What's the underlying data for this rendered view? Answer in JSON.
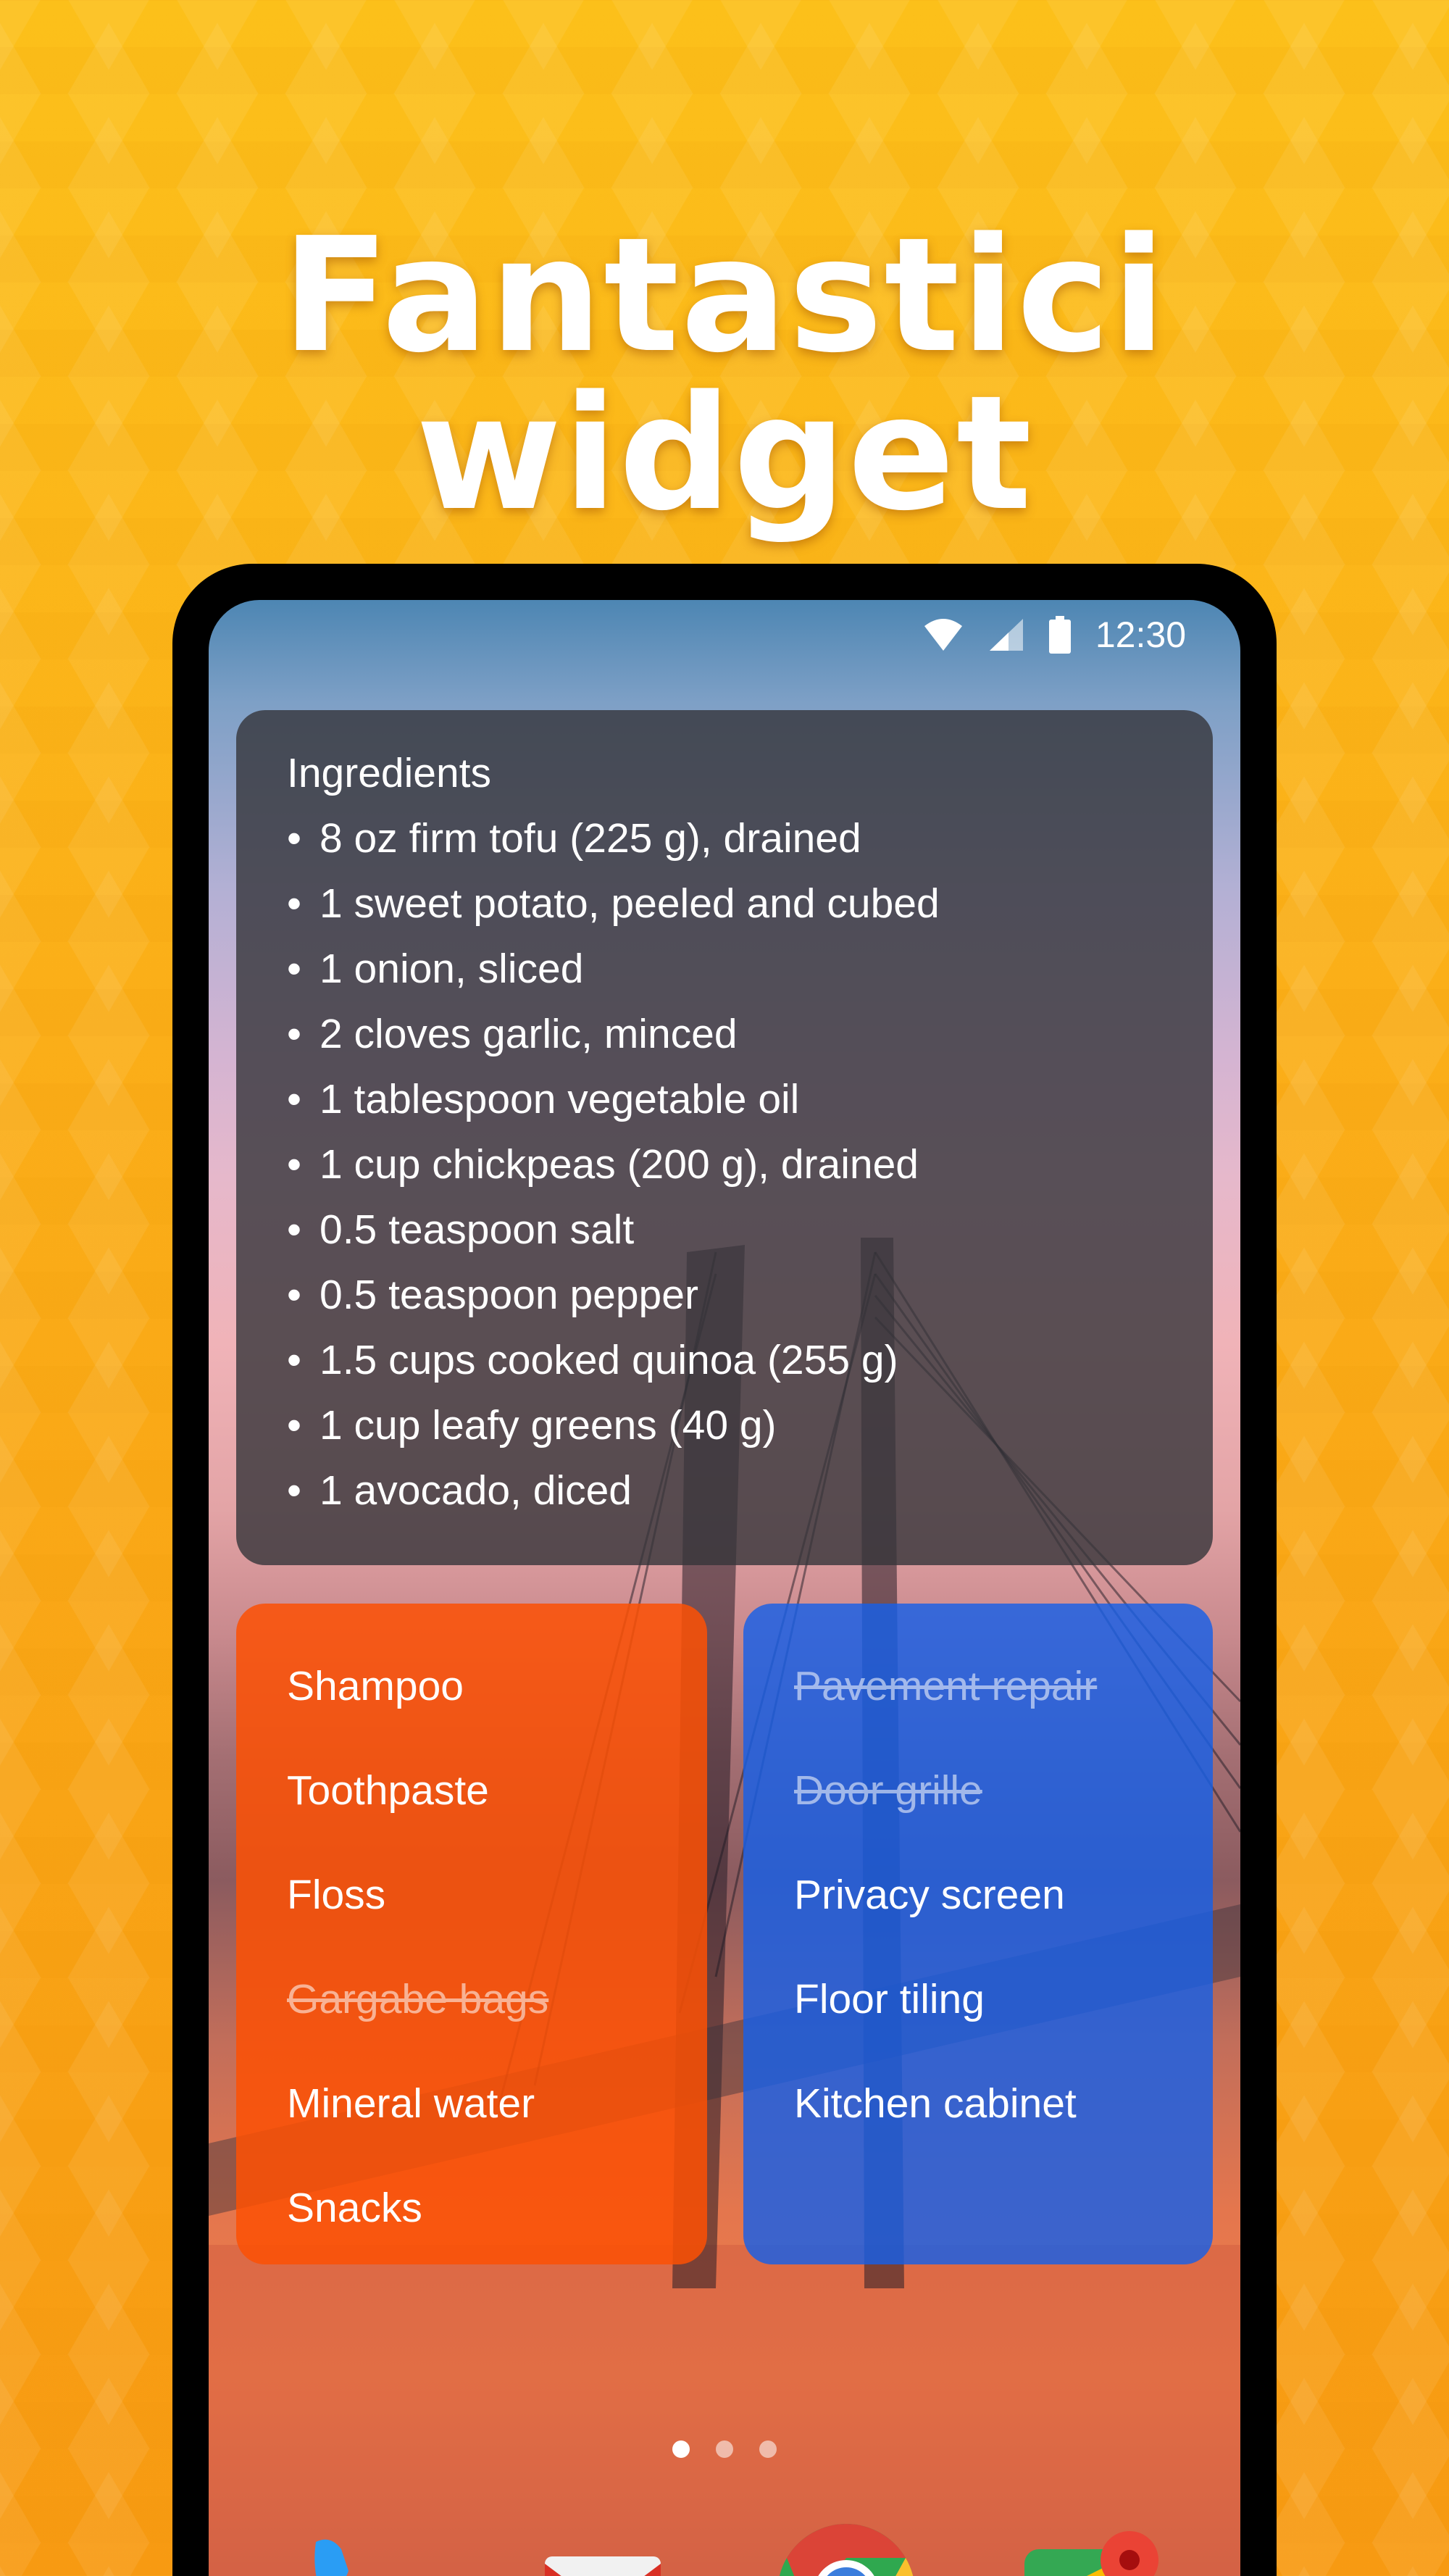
{
  "headline": "Fantastici widget",
  "status_bar": {
    "time": "12:30",
    "icons": [
      "wifi-icon",
      "signal-icon",
      "battery-icon"
    ]
  },
  "ingredients_widget": {
    "title": "Ingredients",
    "items": [
      "8 oz firm tofu (225 g), drained",
      "1 sweet potato, peeled and cubed",
      "1 onion, sliced",
      "2 cloves garlic, minced",
      "1 tablespoon vegetable oil",
      "1 cup chickpeas (200 g), drained",
      "0.5 teaspoon salt",
      "0.5 teaspoon pepper",
      "1.5 cups cooked quinoa (255 g)",
      "1 cup leafy greens (40 g)",
      "1 avocado, diced"
    ]
  },
  "shopping_widget": {
    "items": [
      {
        "label": "Shampoo",
        "done": false
      },
      {
        "label": "Toothpaste",
        "done": false
      },
      {
        "label": "Floss",
        "done": false
      },
      {
        "label": "Gargabe bags",
        "done": true
      },
      {
        "label": "Mineral water",
        "done": false
      },
      {
        "label": "Snacks",
        "done": false
      }
    ]
  },
  "home_widget": {
    "items": [
      {
        "label": "Pavement repair",
        "done": true
      },
      {
        "label": "Door grille",
        "done": true
      },
      {
        "label": "Privacy screen",
        "done": false
      },
      {
        "label": "Floor tiling",
        "done": false
      },
      {
        "label": "Kitchen cabinet",
        "done": false
      }
    ]
  },
  "page_indicator": {
    "pages": 3,
    "current": 1
  },
  "dock": [
    "phone-icon",
    "gmail-icon",
    "chrome-icon",
    "maps-icon"
  ],
  "colors": {
    "background": "#fbae18",
    "orange_widget": "#fc5005",
    "blue_widget": "#165fe8",
    "dark_widget": "#34343a"
  }
}
